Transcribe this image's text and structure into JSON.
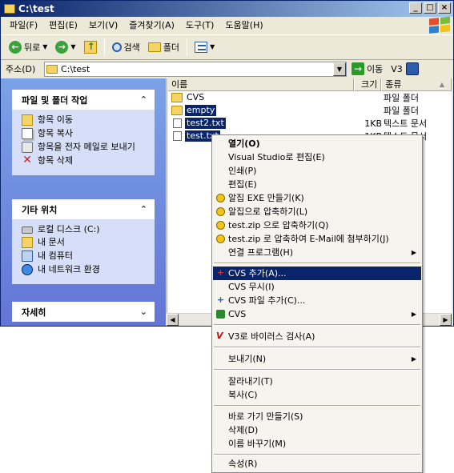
{
  "window": {
    "title": "C:\\test",
    "controls": [
      "_",
      "□",
      "×"
    ]
  },
  "menubar": [
    "파일(F)",
    "편집(E)",
    "보기(V)",
    "즐겨찾기(A)",
    "도구(T)",
    "도움말(H)"
  ],
  "toolbar": {
    "back_label": "뒤로",
    "search_label": "검색",
    "folders_label": "폴더"
  },
  "address": {
    "label": "주소(D)",
    "value": "C:\\test",
    "go_label": "이동",
    "v3_label": "V3"
  },
  "tasks_panel": {
    "title": "파일 및 폴더 작업",
    "items": [
      "항목 이동",
      "항목 복사",
      "항목을 전자 메일로 보내기",
      "항목 삭제"
    ]
  },
  "places_panel": {
    "title": "기타 위치",
    "items": [
      "로컬 디스크 (C:)",
      "내 문서",
      "내 컴퓨터",
      "내 네트워크 환경"
    ]
  },
  "details_panel": {
    "title": "자세히"
  },
  "columns": {
    "name": "이름",
    "size": "크기",
    "type": "종류"
  },
  "files": [
    {
      "name": "CVS",
      "size": "",
      "type": "파일 폴더",
      "kind": "folder",
      "selected": false
    },
    {
      "name": "empty",
      "size": "",
      "type": "파일 폴더",
      "kind": "folder",
      "selected": true
    },
    {
      "name": "test2.txt",
      "size": "1KB",
      "type": "텍스트 문서",
      "kind": "file",
      "selected": true
    },
    {
      "name": "test.txt",
      "size": "1KB",
      "type": "텍스트 문서",
      "kind": "file",
      "selected": true
    }
  ],
  "context_menu": {
    "items": [
      "열기(O)",
      "Visual Studio로 편집(E)",
      "인쇄(P)",
      "편집(E)",
      "알집 EXE 만들기(K)",
      "알집으로 압축하기(L)",
      "test.zip 으로 압축하기(Q)",
      "test.zip 로 압축하여 E-Mail에 첨부하기(J)",
      "연결 프로그램(H)",
      "CVS 추가(A)...",
      "CVS 무시(I)",
      "CVS 파일 추가(C)...",
      "CVS",
      "V3로 바이러스 검사(A)",
      "보내기(N)",
      "잘라내기(T)",
      "복사(C)",
      "바로 가기 만들기(S)",
      "삭제(D)",
      "이름 바꾸기(M)",
      "속성(R)"
    ]
  }
}
